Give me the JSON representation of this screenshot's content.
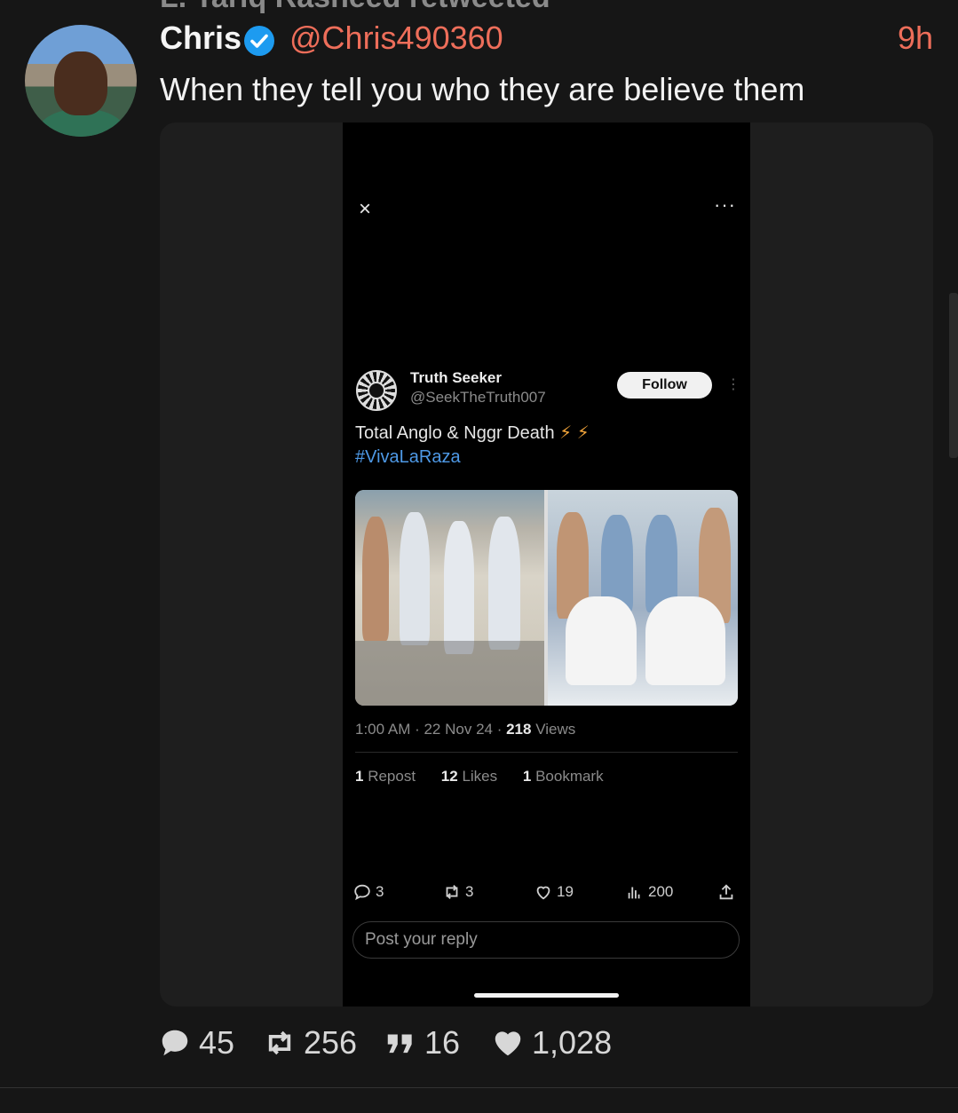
{
  "retweet_header": "L. Tariq Rasheed retweeted",
  "post": {
    "author_name": "Chris",
    "author_handle": "@Chris490360",
    "time_ago": "9h",
    "text": "When they tell you who they are believe them"
  },
  "embedded_screenshot": {
    "close_icon": "×",
    "more_icon": "···",
    "author_name": "Truth Seeker",
    "author_handle": "@SeekTheTruth007",
    "follow_label": "Follow",
    "text": "Total Anglo & Nggr Death",
    "bolts": "⚡ ⚡",
    "hashtag": "#VivaLaRaza",
    "timestamp": "1:00 AM · 22 Nov 24 · ",
    "views_count": "218",
    "views_label": " Views",
    "stats": {
      "reposts_count": "1",
      "reposts_label": " Repost",
      "likes_count": "12",
      "likes_label": " Likes",
      "bookmarks_count": "1",
      "bookmarks_label": " Bookmark"
    },
    "actions": {
      "replies": "3",
      "reposts": "3",
      "likes": "19",
      "views": "200"
    },
    "reply_placeholder": "Post your reply"
  },
  "footer": {
    "replies": "45",
    "reposts": "256",
    "quotes": "16",
    "likes": "1,028"
  },
  "colors": {
    "background": "#161616",
    "accent": "#ee6e5a",
    "verified": "#1d9bf0",
    "hashtag": "#4e99e6"
  }
}
